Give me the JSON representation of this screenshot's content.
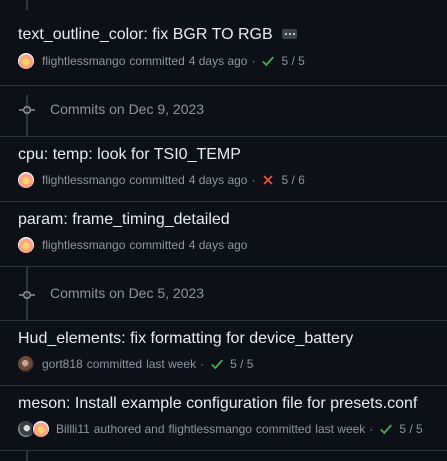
{
  "commits": [
    {
      "title": "text_outline_color: fix BGR TO RGB",
      "author": "flightlessmango",
      "action": "committed",
      "time": "4 days ago",
      "status": "check",
      "checks": "5 / 5"
    },
    {
      "title": "cpu: temp: look for TSI0_TEMP",
      "author": "flightlessmango",
      "action": "committed",
      "time": "4 days ago",
      "status": "cross",
      "checks": "5 / 6"
    },
    {
      "title": "param: frame_timing_detailed",
      "author": "flightlessmango",
      "action": "committed",
      "time": "4 days ago"
    },
    {
      "title": "Hud_elements: fix formatting for device_battery",
      "author": "gort818",
      "action": "committed",
      "time": "last week",
      "status": "check",
      "checks": "5 / 5"
    },
    {
      "title": "meson: Install example configuration file for presets.conf",
      "author": "Billli11",
      "action": "authored and",
      "coauthor": "flightlessmango",
      "coaction": "committed",
      "time": "last week",
      "status": "check",
      "checks": "5 / 5"
    }
  ],
  "days": [
    {
      "label": "Commits on Dec 9, 2023"
    },
    {
      "label": "Commits on Dec 5, 2023"
    }
  ],
  "separator": "·",
  "icons": {
    "check": "check-icon",
    "cross": "x-icon",
    "commit": "git-commit-icon",
    "more": "ellipsis-icon"
  },
  "colors": {
    "background": "#0d1117",
    "border": "#30363d",
    "text": "#e6edf3",
    "muted": "#8d96a0",
    "success": "#3fb950",
    "danger": "#f85149"
  }
}
